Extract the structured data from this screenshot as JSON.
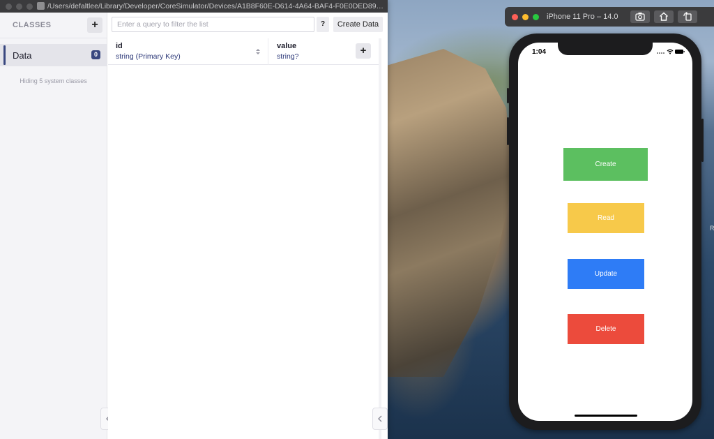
{
  "realm_window": {
    "title_path": "/Users/defaltlee/Library/Developer/CoreSimulator/Devices/A1B8F60E-D614-4A64-BAF4-F0E0DED8983...",
    "sidebar": {
      "title": "CLASSES",
      "add_icon": "plus-icon",
      "classes": [
        {
          "name": "Data",
          "count": "0",
          "selected": true
        }
      ],
      "hidden_note": "Hiding 5 system classes"
    },
    "toolbar": {
      "query_placeholder": "Enter a query to filter the list",
      "query_value": "",
      "help_label": "?",
      "create_label": "Create Data"
    },
    "columns": [
      {
        "name": "id",
        "type": "string (Primary Key)",
        "sortable": true
      },
      {
        "name": "value",
        "type": "string?"
      }
    ],
    "add_property_icon": "plus-icon",
    "collapse_icon": "chevron-left-icon",
    "accent_color": "#39477f"
  },
  "simulator": {
    "title": "iPhone 11 Pro – 14.0",
    "toolbar_icons": [
      "screenshot-icon",
      "home-icon",
      "rotate-icon"
    ],
    "status_time": "1:04",
    "buttons": [
      {
        "label": "Create",
        "color": "#5cbf60"
      },
      {
        "label": "Read",
        "color": "#f7c94a"
      },
      {
        "label": "Update",
        "color": "#2e7cf6"
      },
      {
        "label": "Delete",
        "color": "#ec4b3c"
      }
    ]
  },
  "desktop": {
    "edge_text": "R"
  }
}
